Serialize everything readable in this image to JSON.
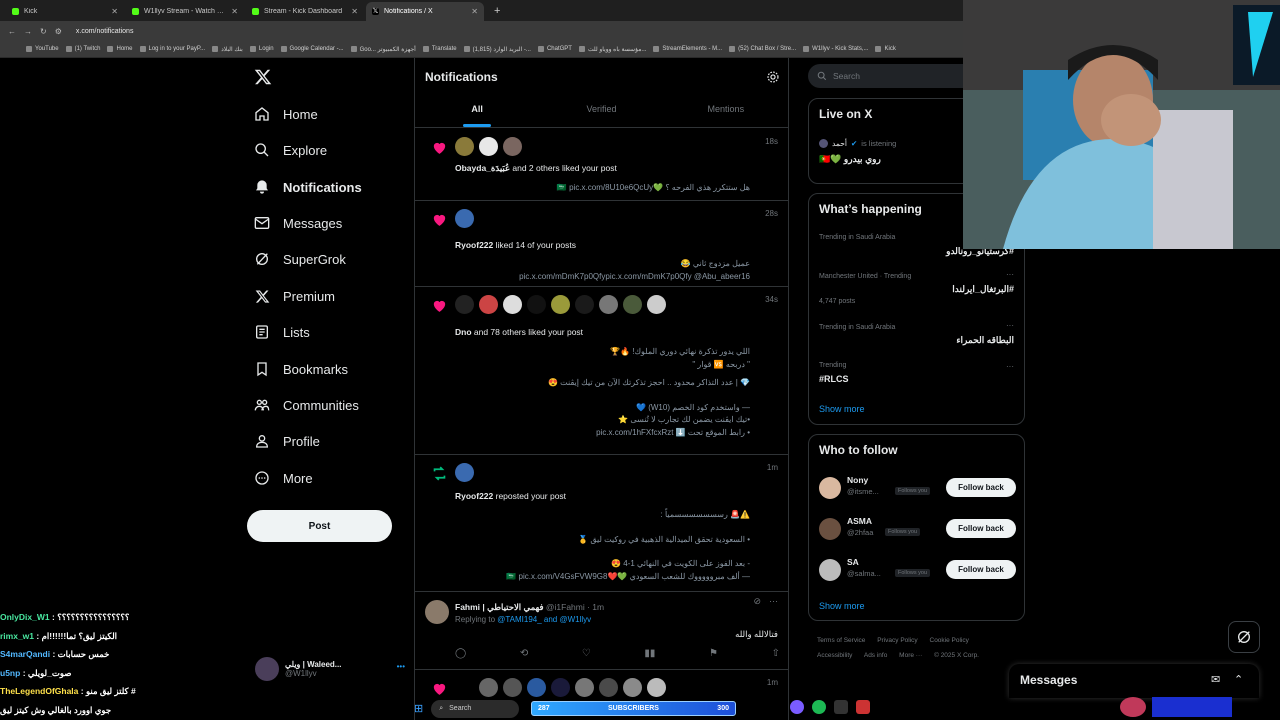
{
  "browser": {
    "tabs": [
      {
        "label": "Kick",
        "color": "#53fc18",
        "active": false
      },
      {
        "label": "W1llyv Stream - Watch Live on",
        "color": "#53fc18",
        "active": false
      },
      {
        "label": "Stream - Kick Dashboard",
        "color": "#53fc18",
        "active": false
      },
      {
        "label": "Notifications / X",
        "color": "#ffffff",
        "active": true
      }
    ],
    "url": "x.com/notifications",
    "bookmarks": [
      "YouTube",
      "(1) Twitch",
      "Home",
      "Log in to your PayP...",
      "بنك البلاد",
      "Login",
      "Google Calendar -...",
      "Goo... أجهزة الكمبيوتر",
      "Translate",
      "البريد الوارد (1,815) -...",
      "ChatGPT",
      "مؤسسة باه ووياو للت...",
      "StreamElements - M...",
      "(52) Chat Box / Stre...",
      "W1llyv - Kick Stats,...",
      "Kick"
    ]
  },
  "nav": {
    "items": [
      {
        "label": "Home",
        "icon": "home-icon"
      },
      {
        "label": "Explore",
        "icon": "search-icon"
      },
      {
        "label": "Notifications",
        "icon": "bell-icon"
      },
      {
        "label": "Messages",
        "icon": "envelope-icon"
      },
      {
        "label": "SuperGrok",
        "icon": "grok-icon"
      },
      {
        "label": "Premium",
        "icon": "x-logo-icon"
      },
      {
        "label": "Lists",
        "icon": "list-icon"
      },
      {
        "label": "Bookmarks",
        "icon": "bookmark-icon"
      },
      {
        "label": "Communities",
        "icon": "people-icon"
      },
      {
        "label": "Profile",
        "icon": "person-icon"
      },
      {
        "label": "More",
        "icon": "more-circle-icon"
      }
    ],
    "post_label": "Post",
    "account": {
      "name": "ويلي | Waleed...",
      "handle": "@W1llyv"
    }
  },
  "main": {
    "title": "Notifications",
    "tabs": [
      "All",
      "Verified",
      "Mentions"
    ],
    "notifications": [
      {
        "type": "like",
        "text_bold": "Obayda_عُبَيدَة",
        "text": " and 2 others liked your post",
        "time": "18s",
        "body": [
          "هل ستتكرر هذي الفرحه ؟ 💚🇸🇦 pic.x.com/8U10e6QcUy"
        ]
      },
      {
        "type": "like",
        "text_bold": "Ryoof222",
        "text": " liked 14 of your posts",
        "time": "28s",
        "body": [
          "عميل مزدوج ثاني 😂",
          "pic.x.com/mDmK7p0Qfypic.x.com/mDmK7p0Qfy @Abu_abeer16"
        ]
      },
      {
        "type": "like",
        "text_bold": "Dno",
        "text": " and 78 others liked your post",
        "time": "34s",
        "body": [
          "اللي يدور تذكرة نهائي دوري الملوك! 🔥🏆",
          "\" دربحه 🆚 قوار \"",
          "",
          "💎 | عدد التذاكر محدود .. احجز تذكرتك الآن من تيك إيڤنت 😍",
          "",
          "— واستخدم كود الخصم (W10) 💙",
          "•تيك ايڤنت يضمن لك تجارب لا تُنسى ⭐",
          "• رابط الموقع تحت ⬇️ pic.x.com/1hFXfcxRzt"
        ]
      },
      {
        "type": "repost",
        "text_bold": "Ryoof222",
        "text": " reposted your post",
        "time": "1m",
        "body": [
          "⚠️🚨 رسسسسسسسمياً :",
          "",
          "• السعودية تحقق الميدالية الذهبية في روكيت ليق 🥇",
          "",
          "- بعد الفوز على الكويت في النهائي 1-4 😍",
          "— ألف مبروووووك للشعب السعودي 💚❤️🇸🇦 pic.x.com/V4GsFVW9G8"
        ]
      }
    ],
    "reply": {
      "name": "Fahmi | فهمي الاحتياطي",
      "handle": "@i1Fahmi · 1m",
      "replying_prefix": "Replying to ",
      "replying_to": "@TAMI194_ and @W1llyv",
      "body": "فتالالله والله"
    },
    "last_time": "1m"
  },
  "right": {
    "search_placeholder": "Search",
    "live": {
      "title": "Live on X",
      "host": "أحمد",
      "status": "is listening",
      "room": "روي بيدرو 💚🇵🇹"
    },
    "happening": {
      "title": "What’s happening",
      "trends": [
        {
          "context": "Trending in Saudi Arabia",
          "name": "#كرستيانو_رونالدو",
          "posts": ""
        },
        {
          "context": "Manchester United · Trending",
          "name": "#البرتغال_ايرلندا",
          "posts": "4,747 posts"
        },
        {
          "context": "Trending in Saudi Arabia",
          "name": "البطاقه الحمراء",
          "posts": ""
        },
        {
          "context": "Trending",
          "name": "#RLCS",
          "posts": ""
        }
      ],
      "show_more": "Show more"
    },
    "follow": {
      "title": "Who to follow",
      "people": [
        {
          "name": "Nony",
          "handle": "@itsme...",
          "badge": "Follows you",
          "button": "Follow back"
        },
        {
          "name": "ASMA",
          "handle": "@2hfaa",
          "badge": "Follows you",
          "button": "Follow back"
        },
        {
          "name": "SA",
          "handle": "@salma...",
          "badge": "Follows you",
          "button": "Follow back"
        }
      ],
      "show_more": "Show more"
    },
    "footer": [
      "Terms of Service",
      "Privacy Policy",
      "Cookie Policy",
      "Accessibility",
      "Ads info",
      "More ···",
      "© 2025 X Corp."
    ],
    "messages_label": "Messages"
  },
  "overlay": {
    "chat": [
      {
        "user": "OnlyDix_W1",
        "msg": ": ؟؟؟؟؟؟؟؟؟؟؟؟؟؟؟؟",
        "cls": "u"
      },
      {
        "user": "rimx_w1",
        "msg": ": الكيتز ليق؟ تما!!!!!!ام",
        "cls": "u"
      },
      {
        "user": "S4marQandi",
        "msg": ": خمس حسابات",
        "cls": "u2"
      },
      {
        "user": "u5np",
        "msg": ": صوت_لويلي",
        "cls": "u2"
      },
      {
        "user": "TheLegendOfGhala",
        "msg": ": كلتز ليق منو #",
        "cls": "u3"
      },
      {
        "user": "",
        "msg": "جوي اوورد بالغالي وش كيتز ليق",
        "cls": "m"
      }
    ],
    "subs_count": "287",
    "subs_label": "SUBSCRIBERS",
    "subs_goal": "300",
    "taskbar_search": "Search"
  }
}
